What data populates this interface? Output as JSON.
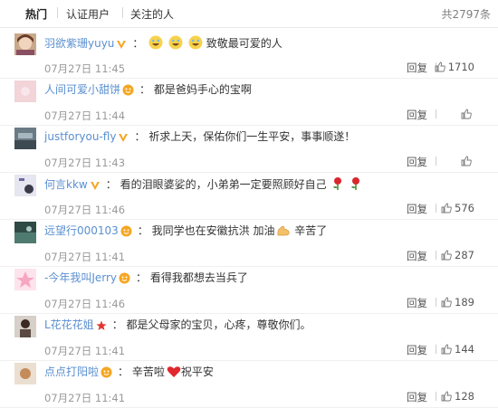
{
  "tabs": [
    "热门",
    "认证用户",
    "关注的人"
  ],
  "total": "共2797条",
  "reply_label": "回复",
  "colors": {
    "username": "#5a8fd0",
    "badge_orange": "#f5a623",
    "badge_red": "#e0382d"
  },
  "comments": [
    {
      "user": "羽欲紫珊yuyu",
      "badge": "v-yellow",
      "text": "致敬最可爱的人",
      "time": "07月27日 11:45",
      "likes": "1710",
      "emoji": [
        "grin-tears",
        "grin-tears",
        "grin-tears"
      ]
    },
    {
      "user": "人间可爱小甜饼",
      "badge": "orange-dot",
      "text": "都是爸妈手心的宝啊",
      "time": "07月27日 11:44",
      "likes": "",
      "emoji": []
    },
    {
      "user": "justforyou-fly",
      "badge": "v-yellow",
      "text": "祈求上天，保佑你们一生平安，事事顺遂！",
      "time": "07月27日 11:43",
      "likes": "",
      "emoji": []
    },
    {
      "user": "何言kkw",
      "badge": "v-yellow",
      "text": "看的泪眼婆娑的，小弟弟一定要照顾好自己",
      "time": "07月27日 11:46",
      "likes": "576",
      "emoji": [
        "rose",
        "rose"
      ]
    },
    {
      "user": "远望行000103",
      "badge": "orange-dot",
      "text": "我同学也在安徽抗洪 加油",
      "text_after": " 辛苦了",
      "time": "07月27日 11:41",
      "likes": "287",
      "emoji": [
        "muscle"
      ]
    },
    {
      "user": "-今年我叫Jerry",
      "badge": "orange-dot",
      "text": "看得我都想去当兵了",
      "time": "07月27日 11:46",
      "likes": "189",
      "emoji": []
    },
    {
      "user": "L花花花姐",
      "badge": "red-star",
      "text": "都是父母家的宝贝，心疼，尊敬你们。",
      "time": "07月27日 11:41",
      "likes": "144",
      "emoji": []
    },
    {
      "user": "点点打阳啦",
      "badge": "orange-dot",
      "text": "辛苦啦",
      "text_after": "祝平安",
      "time": "07月27日 11:41",
      "likes": "128",
      "emoji": [
        "heart"
      ]
    }
  ]
}
